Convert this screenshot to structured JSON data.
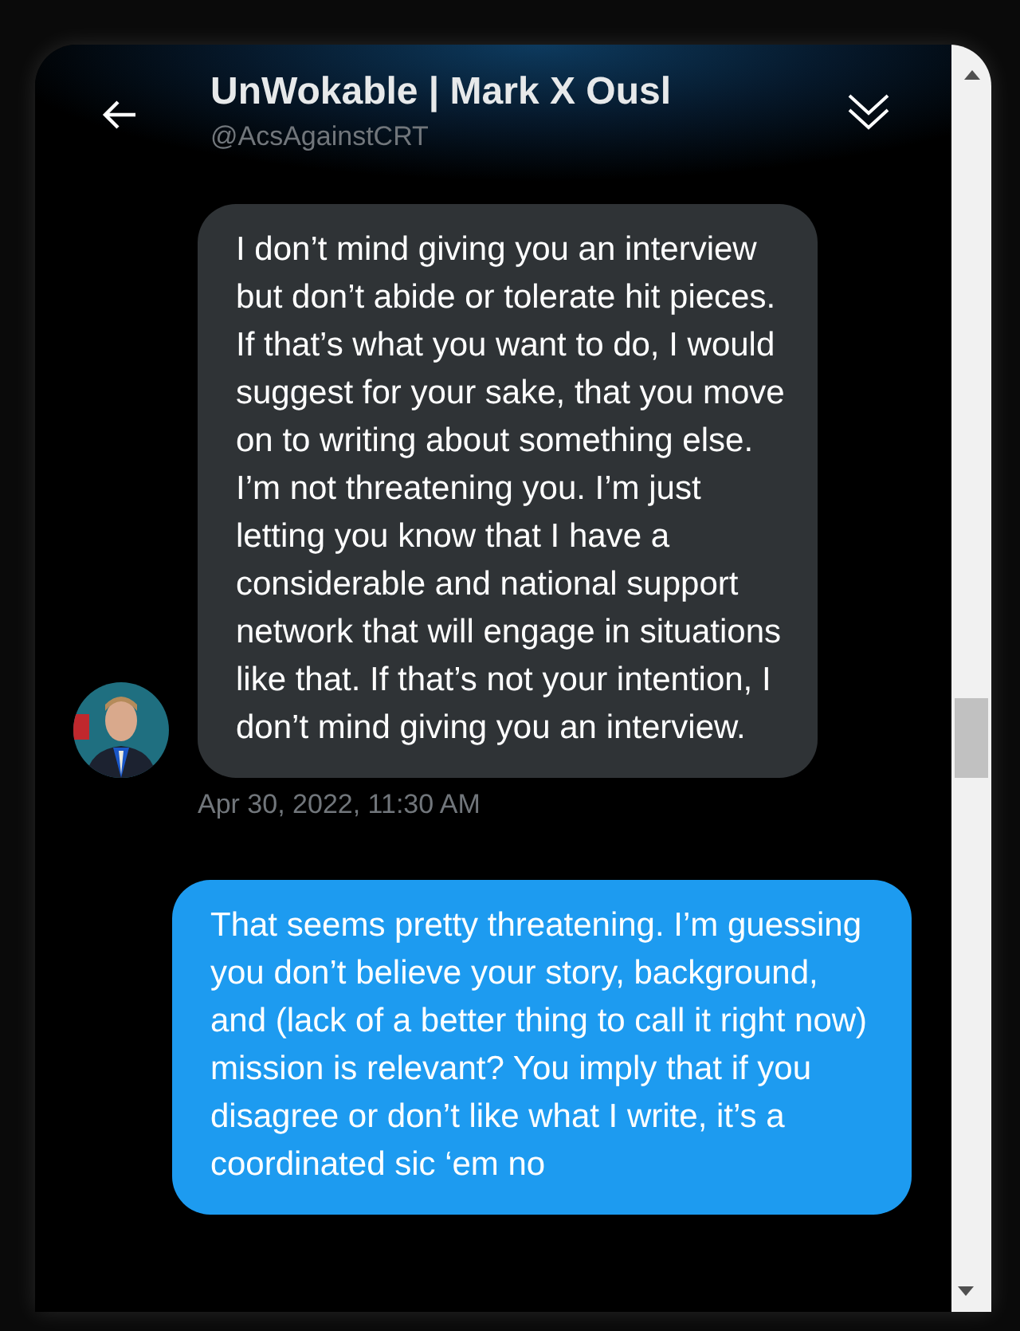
{
  "header": {
    "name": "UnWokable | Mark X Ousl",
    "handle": "@AcsAgainstCRT"
  },
  "messages": [
    {
      "kind": "received",
      "text": "I don’t mind giving you an interview but don’t abide or tolerate hit pieces. If that’s what you want to do, I would suggest for your sake, that you move on to writing about something else. I’m not threatening you. I’m just letting you know that I have a considerable and national support network that will engage in situations like that. If that’s not your intention, I don’t mind giving you an interview.",
      "time": "Apr 30, 2022, 11:30 AM"
    },
    {
      "kind": "sent",
      "text": "That seems pretty threatening.  I’m guessing you don’t believe your story, background, and (lack of a better thing to call it right now) mission is relevant?  You imply that if you disagree or don’t like what I write, it’s a coordinated sic ‘em no"
    }
  ]
}
